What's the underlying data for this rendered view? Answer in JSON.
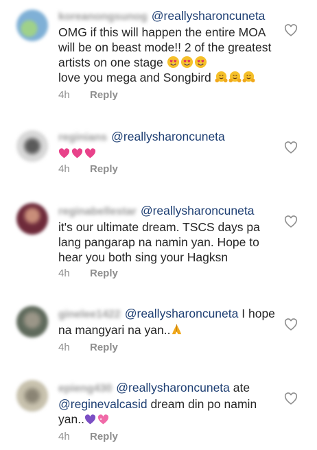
{
  "comments": [
    {
      "username": "koreanongsunog",
      "mention": "@reallysharoncuneta",
      "text": "OMG if this will happen the entire MOA will be on beast mode!! 2 of the greatest artists on one stage",
      "text2": "love you mega and Songbird",
      "time": "4h",
      "reply": "Reply",
      "avatar_color": "#7fb0d6",
      "emojis": [
        "heart-eyes-face-icon",
        "heart-eyes-face-icon",
        "heart-eyes-face-icon",
        "hugging-face-icon",
        "hugging-face-icon",
        "hugging-face-icon"
      ]
    },
    {
      "username": "reginians",
      "mention": "@reallysharoncuneta",
      "text": "",
      "time": "4h",
      "reply": "Reply",
      "avatar_color": "#cfcfcf",
      "emojis": [
        "pink-heart-icon",
        "pink-heart-icon",
        "pink-heart-icon"
      ]
    },
    {
      "username": "reginabellestar",
      "mention": "@reallysharoncuneta",
      "text": "it's our ultimate dream. TSCS days pa lang pangarap na namin yan. Hope to hear you both sing your Hagksn",
      "time": "4h",
      "reply": "Reply",
      "avatar_color": "#8a3b4a"
    },
    {
      "username": "ginelee1422",
      "mention": "@reallysharoncuneta",
      "text": "I hope na mangyari na yan..",
      "time": "4h",
      "reply": "Reply",
      "avatar_color": "#7a7a6a",
      "emojis": [
        "folded-hands-icon"
      ]
    },
    {
      "username": "epieng430",
      "mention": "@reallysharoncuneta",
      "text": "ate",
      "mention2": "@reginevalcasid",
      "text2": " dream din po namin yan..",
      "time": "4h",
      "reply": "Reply",
      "avatar_color": "#b7b09c",
      "emojis": [
        "purple-heart-icon",
        "sparkling-heart-icon"
      ]
    }
  ],
  "colors": {
    "text": "#262626",
    "mention": "#1e3f73",
    "meta": "#8e8e8e",
    "heart_outline": "#8e8e8e"
  }
}
